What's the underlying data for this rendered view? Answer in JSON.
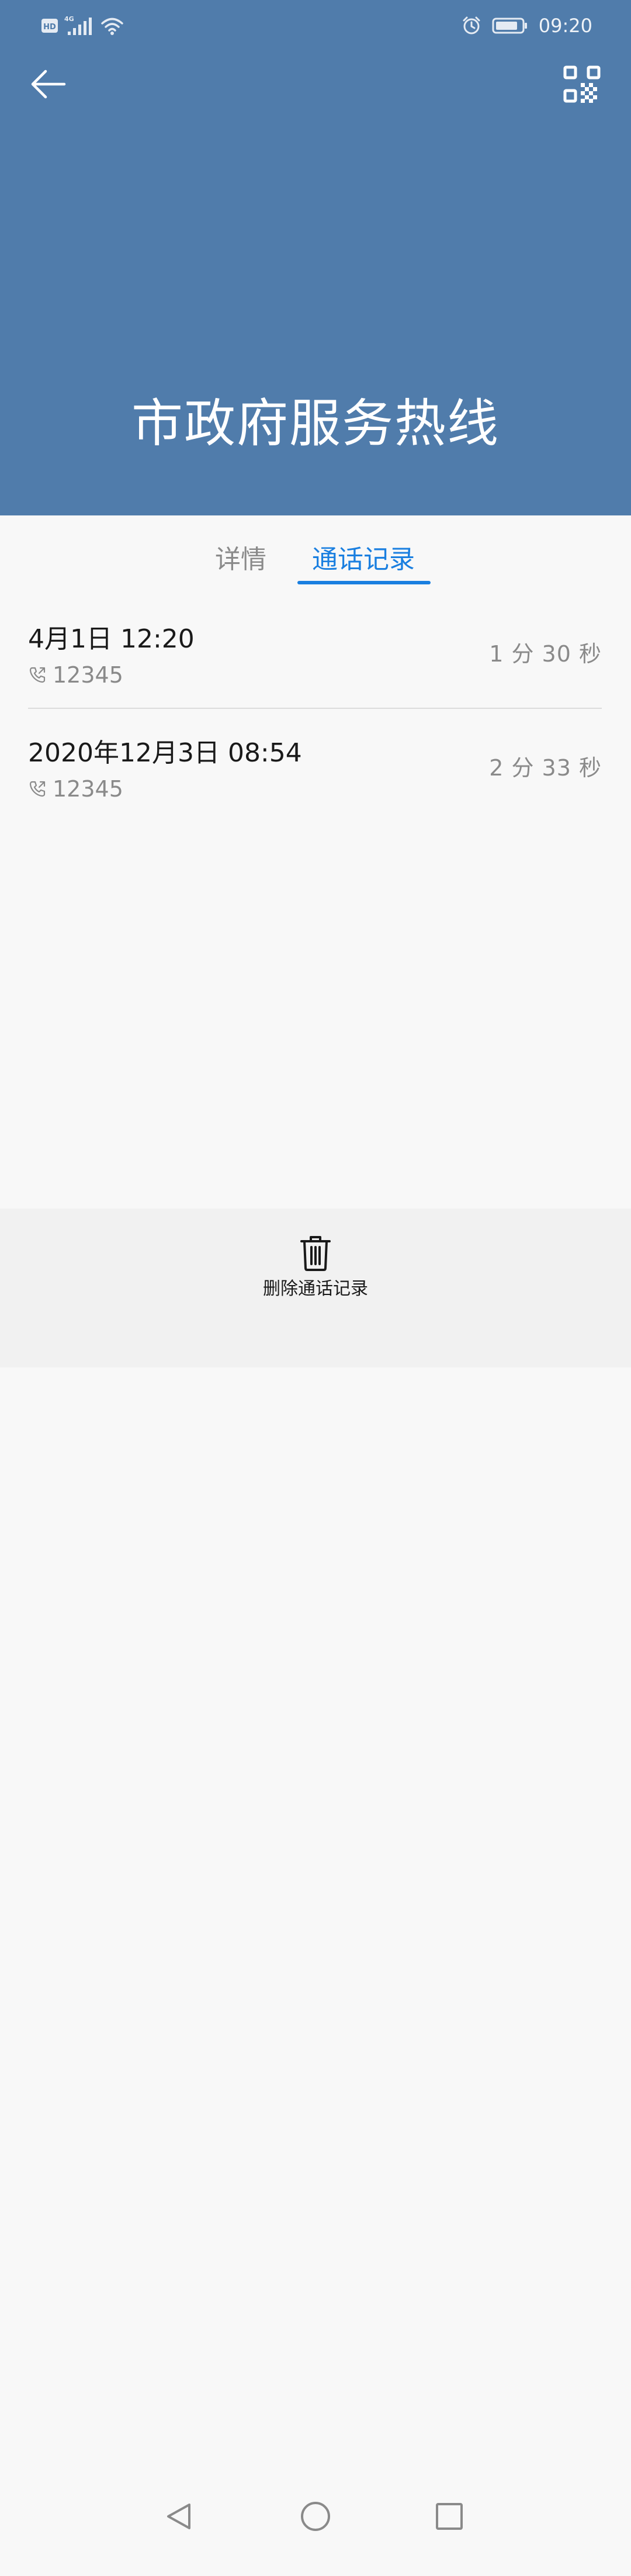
{
  "status_bar": {
    "network_label": "HD",
    "network_type": "4G",
    "time": "09:20",
    "icons": [
      "hd-icon",
      "signal-icon",
      "wifi-icon",
      "alarm-icon",
      "battery-icon"
    ]
  },
  "header": {
    "contact_name": "市政府服务热线",
    "back_icon": "arrow-left-icon",
    "qr_icon": "qr-code-icon",
    "background_color": "#507cab"
  },
  "tabs": [
    {
      "label": "详情",
      "active": false
    },
    {
      "label": "通话记录",
      "active": true
    }
  ],
  "accent_color": "#1a7fe0",
  "call_log": [
    {
      "datetime": "4月1日 12:20",
      "number": "12345",
      "duration": "1 分 30 秒"
    },
    {
      "datetime": "2020年12月3日 08:54",
      "number": "12345",
      "duration": "2 分 33 秒"
    }
  ],
  "bottom_action": {
    "label": "删除通话记录",
    "icon": "trash-icon"
  },
  "nav": {
    "icons": [
      "nav-back-icon",
      "nav-home-icon",
      "nav-recent-icon"
    ]
  }
}
